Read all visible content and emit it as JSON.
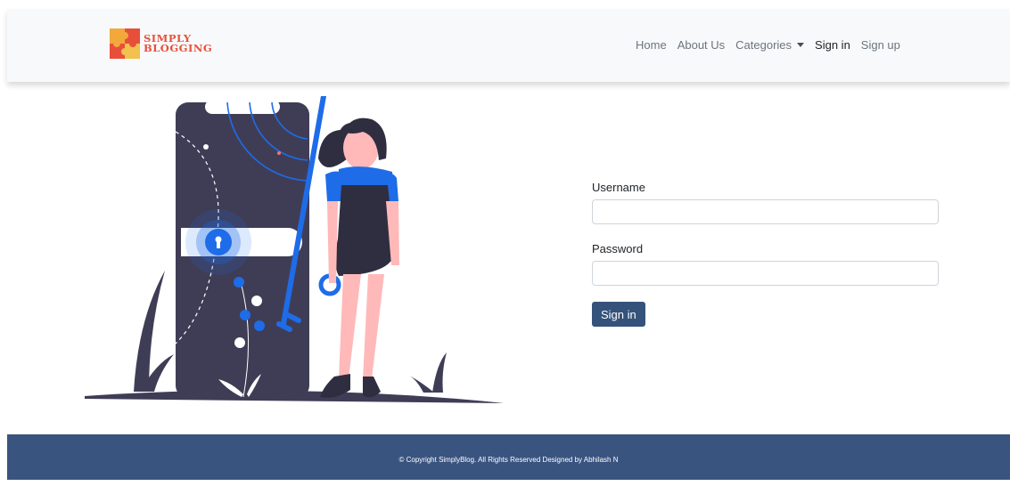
{
  "brand": {
    "line1": "SIMPLY",
    "line2": "BLOGGING"
  },
  "nav": {
    "home": "Home",
    "about": "About Us",
    "categories": "Categories",
    "signin": "Sign in",
    "signup": "Sign up"
  },
  "form": {
    "username_label": "Username",
    "username_value": "",
    "password_label": "Password",
    "password_value": "",
    "submit_label": "Sign in"
  },
  "footer": {
    "text": "© Copyright SimplyBlog. All Rights Reserved Designed by Abhilash N"
  },
  "colors": {
    "primary": "#34527a",
    "footer_bg": "#3a5480",
    "accent_blue": "#1e6ce8",
    "brand_red": "#e8503a"
  }
}
